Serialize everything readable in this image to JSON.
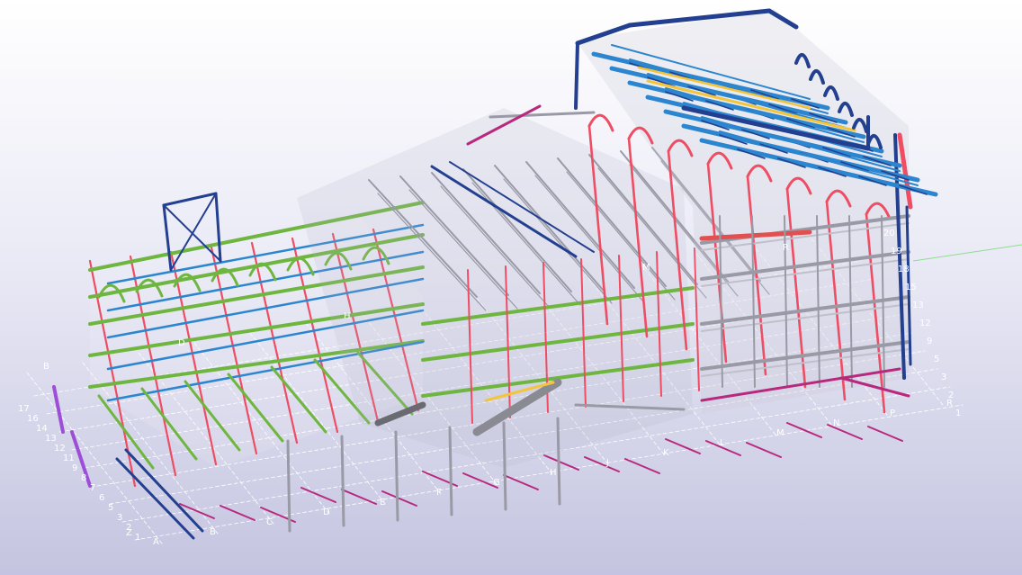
{
  "viewport": {
    "background_top": "#ffffff",
    "background_bottom": "#c4c4e0"
  },
  "palette": {
    "column_red": "#ee4d63",
    "beam_green": "#6fb640",
    "beam_blue": "#2b86cf",
    "beam_navy": "#233f8f",
    "beam_magenta": "#b8297e",
    "steel_grey": "#9a9aa6",
    "brace_yellow": "#f3c53a",
    "grid_line": "#ffffff"
  },
  "grid_labels": {
    "front_letters": [
      "A",
      "B",
      "C",
      "D",
      "E",
      "F",
      "G",
      "H",
      "J",
      "K",
      "L",
      "M",
      "N",
      "P",
      "R"
    ],
    "left_numbers": [
      "1",
      "2",
      "3",
      "5",
      "6",
      "7",
      "8",
      "9",
      "11",
      "12",
      "13",
      "14",
      "16",
      "17"
    ],
    "left_letters": [
      "B",
      "Z"
    ],
    "right_numbers": [
      "1",
      "2",
      "3",
      "5",
      "9",
      "12",
      "13",
      "15",
      "18",
      "19",
      "20"
    ],
    "right_letters": [
      "R"
    ],
    "inner_letters": [
      "D",
      "M",
      "H"
    ]
  }
}
